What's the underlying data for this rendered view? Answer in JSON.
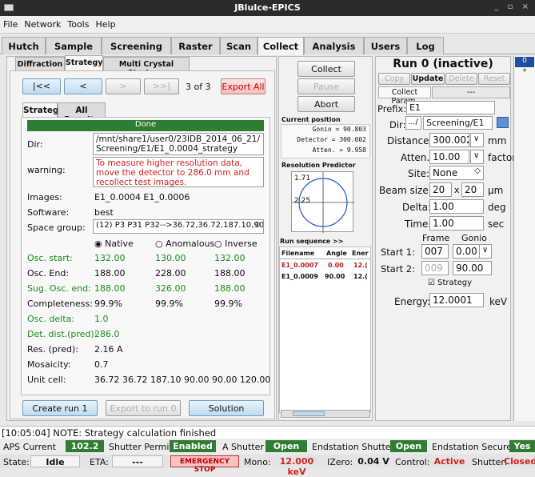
{
  "window": {
    "title": "JBluIce-EPICS",
    "controls": "_ ▫ ×"
  },
  "menu": [
    "File",
    "Network",
    "Tools",
    "Help"
  ],
  "tabs": [
    "Hutch",
    "Sample",
    "Screening",
    "Raster",
    "Scan",
    "Collect",
    "Analysis",
    "Users",
    "Log"
  ],
  "left": {
    "subtabs": [
      "Diffraction",
      "Strategy",
      "Multi Crystal Strategy"
    ],
    "nav": {
      "first": "|<<",
      "prev": "<",
      "next": ">",
      "last": ">>|",
      "count": "3 of 3",
      "export_all": "Export All"
    },
    "inner_tabs": [
      "Strategy",
      "All Results"
    ],
    "done": "Done",
    "rows": {
      "dir_label": "Dir:",
      "dir_value": "/mnt/share1/user0/23IDB_2014_06_21/ Screening/E1/E1_0.0004_strategy",
      "warning_label": "warning:",
      "warning_value": "To measure higher resolution data, move the detector to 286.0 mm and recollect test images.",
      "images_label": "Images:",
      "images_value": "E1_0.0004 E1_0.0006",
      "software_label": "Software:",
      "software_value": "best",
      "space_label": "Space group:",
      "space_value": "(12) P3 P31 P32-->36.72,36.72,187.10,90.00,9"
    },
    "radios": [
      "Native",
      "Anomalous",
      "Inverse"
    ],
    "table": [
      {
        "label": "Osc. start:",
        "vals": [
          "132.00",
          "130.00",
          "132.00"
        ],
        "green": true
      },
      {
        "label": "Osc. End:",
        "vals": [
          "188.00",
          "228.00",
          "188.00"
        ],
        "green": false
      },
      {
        "label": "Sug. Osc. end:",
        "vals": [
          "188.00",
          "326.00",
          "188.00"
        ],
        "green": true
      },
      {
        "label": "Completeness:",
        "vals": [
          "99.9%",
          "99.9%",
          "99.9%"
        ],
        "green": false
      },
      {
        "label": "Osc. delta:",
        "vals": [
          "1.0"
        ],
        "green": true
      },
      {
        "label": "Det. dist.(pred):",
        "vals": [
          "286.0"
        ],
        "green": true
      },
      {
        "label": "Res. (pred):",
        "vals": [
          "2.16 A"
        ],
        "green": false
      },
      {
        "label": "Mosaicity:",
        "vals": [
          "0.7"
        ],
        "green": false
      },
      {
        "label": "Unit cell:",
        "vals": [
          "36.72 36.72 187.10 90.00 90.00 120.00"
        ],
        "green": false
      }
    ],
    "buttons": {
      "create": "Create run 1",
      "export_run": "Export to run 0",
      "solution": "Solution"
    }
  },
  "middle": {
    "collect": "Collect",
    "pause": "Pause",
    "abort": "Abort",
    "pos_title": "Current position",
    "gonio": "Gonio = 90.803",
    "detector": "Detector = 300.002",
    "atten": "Atten. = 9.958",
    "res_title": "Resolution Predictor",
    "res1": "1.71",
    "res2": "2.25",
    "runseq": "Run sequence >>",
    "seq_headers": [
      "Filename",
      "Angle",
      "Ener"
    ],
    "seq_rows": [
      [
        "E1_0.0007",
        "0.00",
        "12.("
      ],
      [
        "E1_0.0009",
        "90.00",
        "12.("
      ]
    ]
  },
  "right": {
    "title": "Run 0 (inactive)",
    "btns": [
      "Copy",
      "Update",
      "Delete",
      "Reset"
    ],
    "collect_param": "Collect Param.",
    "dashes": "---",
    "prefix_label": "Prefix:",
    "prefix": "E1",
    "dir_label": "Dir:",
    "dir_a": ".../",
    "dir_b": "Screening/E1",
    "distance_label": "Distance:",
    "distance": "300.002",
    "distance_unit": "mm",
    "atten_label": "Atten.:",
    "atten": "10.00",
    "atten_unit": "factor",
    "site_label": "Site:",
    "site": "None",
    "beam_label": "Beam size:",
    "beam_x": "20",
    "beam_sep": "x",
    "beam_y": "20",
    "beam_unit": "μm",
    "delta_label": "Delta:",
    "delta": "1.00",
    "delta_unit": "deg",
    "time_label": "Time:",
    "time": "1.00",
    "time_unit": "sec",
    "frame": "Frame",
    "gonio": "Gonio",
    "start1_label": "Start 1:",
    "start1_frame": "007",
    "start1_gonio": "0.00",
    "start2_label": "Start 2:",
    "start2_frame": "009",
    "start2_gonio": "90.00",
    "strategy": "Strategy",
    "energy_label": "Energy:",
    "energy": "12.0001",
    "energy_unit": "keV",
    "run_tab": "0",
    "run_tab_star": "*"
  },
  "log": "[10:05:04] NOTE: Strategy calculation finished",
  "status1": {
    "aps_label": "APS Current",
    "aps": "102.2",
    "shutter_permit": "Shutter Permit",
    "enabled": "Enabled",
    "ashutter": "A Shutter",
    "open1": "Open",
    "end_shutter": "Endstation Shutter",
    "open2": "Open",
    "end_secure": "Endstation Secure",
    "yes": "Yes"
  },
  "status2": {
    "state_label": "State:",
    "state": "Idle",
    "eta_label": "ETA:",
    "eta": "---",
    "estop": "EMERGENCY STOP",
    "mono_label": "Mono:",
    "mono": "12.000 keV",
    "izero_label": "IZero:",
    "izero": "0.04 V",
    "control_label": "Control:",
    "control": "Active",
    "shutter_label": "Shutter:",
    "shutter": "Closed"
  }
}
